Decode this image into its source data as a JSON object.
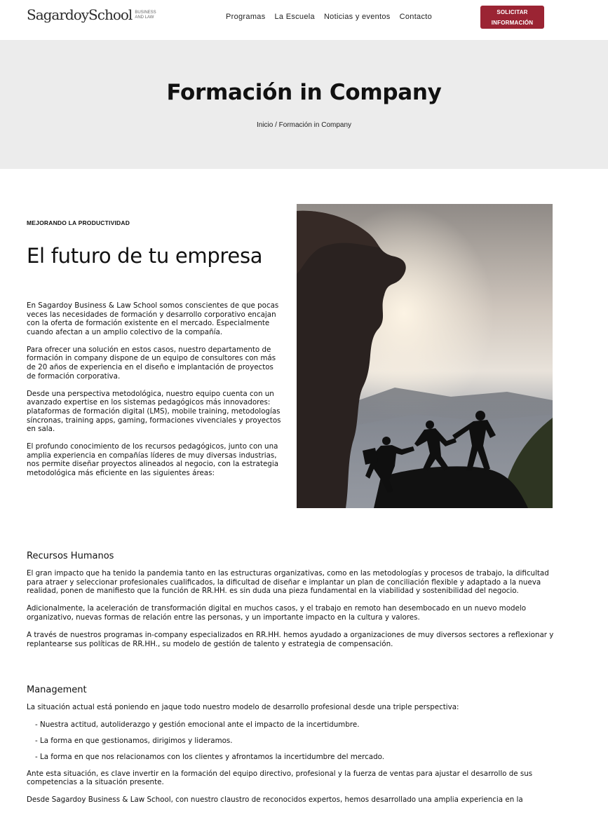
{
  "header": {
    "logo_main": "SagardoySchool",
    "logo_sub_1": "BUSINESS",
    "logo_sub_2": "AND LAW",
    "nav": [
      "Programas",
      "La Escuela",
      "Noticias y eventos",
      "Contacto"
    ],
    "cta_line1": "SOLICITAR",
    "cta_line2": "INFORMACIÓN"
  },
  "hero": {
    "title": "Formación in Company",
    "breadcrumb_home": "Inicio",
    "breadcrumb_sep": " / ",
    "breadcrumb_current": "Formación in Company"
  },
  "intro": {
    "eyebrow": "MEJORANDO LA PRODUCTIVIDAD",
    "title": "El futuro de tu empresa",
    "paragraphs": [
      "En Sagardoy Business & Law School somos conscientes de que pocas veces las necesidades de formación y desarrollo corporativo encajan con la oferta de formación existente en el mercado. Especialmente cuando afectan a un amplio colectivo de la compañía.",
      "Para ofrecer una solución en estos casos, nuestro departamento de formación in company dispone de un equipo de consultores con más de 20 años de experiencia en el diseño e implantación de proyectos de formación corporativa.",
      "Desde una perspectiva metodológica, nuestro equipo cuenta con un avanzado expertise en los sistemas pedagógicos más innovadores: plataformas de formación digital (LMS), mobile training, metodologías síncronas, training apps, gaming, formaciones vivenciales y proyectos en sala.",
      "El profundo conocimiento de los recursos pedagógicos, junto con una amplia experiencia en compañías líderes de muy diversas industrias, nos permite diseñar proyectos alineados al negocio, con la estrategia metodológica más eficiente en las siguientes áreas:"
    ]
  },
  "rrhh": {
    "title": "Recursos Humanos",
    "paragraphs": [
      "El gran impacto que ha tenido la pandemia tanto en las estructuras organizativas, como en las metodologías y procesos de trabajo, la dificultad para atraer y seleccionar profesionales cualificados, la dificultad de diseñar e implantar un plan de conciliación flexible y adaptado a la nueva realidad, ponen de manifiesto que la función de RR.HH. es sin duda una pieza fundamental en la viabilidad y sostenibilidad del negocio.",
      "Adicionalmente, la aceleración de transformación digital en muchos casos, y el trabajo en remoto han desembocado en un nuevo modelo organizativo, nuevas formas de relación entre las personas, y un importante impacto en la cultura y valores.",
      "A través de nuestros programas in-company especializados en RR.HH. hemos ayudado a organizaciones de muy diversos sectores a reflexionar y replantearse sus políticas de RR.HH., su modelo de gestión de talento y estrategia de compensación."
    ]
  },
  "management": {
    "title": "Management",
    "intro": "La situación actual está poniendo en jaque todo nuestro modelo de desarrollo profesional desde una triple perspectiva:",
    "items": [
      "- Nuestra actitud, autoliderazgo y gestión emocional ante el impacto de la incertidumbre.",
      "- La forma en que gestionamos, dirigimos y lideramos.",
      "- La forma en que nos relacionamos con los clientes y afrontamos la incertidumbre del mercado."
    ],
    "after": "Ante esta situación, es clave invertir en la formación del equipo directivo, profesional y la fuerza de ventas para ajustar el desarrollo de sus competencias a la situación presente.",
    "last": "Desde Sagardoy Business & Law School, con nuestro claustro de reconocidos expertos, hemos desarrollado una amplia experiencia en la"
  },
  "colors": {
    "accent": "#9b2433",
    "hero_bg": "#ececec"
  },
  "image": {
    "subject": "silhouettes-helping-climb-mountain-sunset"
  }
}
